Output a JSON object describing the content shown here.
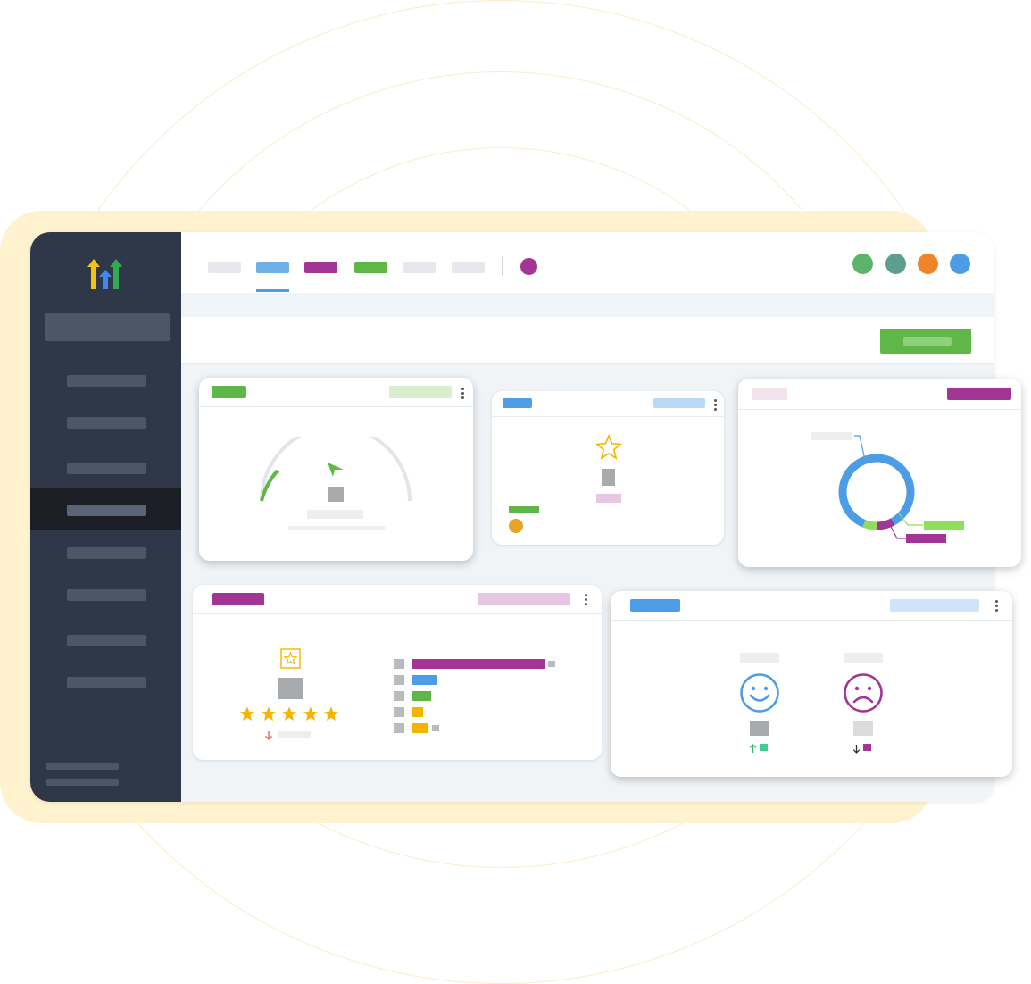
{
  "colors": {
    "sidebar": "#2e3848",
    "sidebar_active": "#1b1e25",
    "purple": "#a23596",
    "green": "#5fb748",
    "blue": "#4d9de6",
    "light_green": "#d9edcf",
    "light_blue": "#b8d8f6",
    "light_purple": "#e6c6e2",
    "orange": "#f18429",
    "teal": "#5e9e8c",
    "gold": "#f4b400",
    "backdrop": "#fff2cf"
  },
  "header": {
    "tabs": [
      {
        "name": "tab-1",
        "color": "#e6e8eb",
        "active": false
      },
      {
        "name": "tab-2",
        "color": "#6fb0e6",
        "active": true
      },
      {
        "name": "tab-3",
        "color": "#a23596",
        "active": false
      },
      {
        "name": "tab-4",
        "color": "#5fb748",
        "active": false
      },
      {
        "name": "tab-5",
        "color": "#e6e8eb",
        "active": false
      },
      {
        "name": "tab-6",
        "color": "#e6e8eb",
        "active": false
      }
    ],
    "status_dot_color": "#a23596",
    "avatars": [
      "#5ab46a",
      "#5e9e8c",
      "#f18429",
      "#4d9de6"
    ]
  },
  "icons": {
    "logo": "gohighlevel-arrows-icon",
    "gauge_pointer": "pointer-arrow-icon",
    "star_outline": "star-outline-icon",
    "star_box": "star-box-icon",
    "stars": "filled-star-icon",
    "trend_down": "arrow-down-icon",
    "trend_up": "arrow-up-icon",
    "happy": "smiley-face-icon",
    "sad": "sad-face-icon",
    "kebab": "more-vertical-icon"
  },
  "gauge": {
    "filled_fraction": 0.12
  },
  "donut": {
    "segments": [
      {
        "share": 0.86,
        "color": "#4d9de6"
      },
      {
        "share": 0.08,
        "color": "#a23596"
      },
      {
        "share": 0.06,
        "color": "#8ee05c"
      }
    ]
  },
  "rating": {
    "stars": 5
  },
  "bars": {
    "rows": [
      {
        "value": 1.0,
        "color": "#a23596"
      },
      {
        "value": 0.18,
        "color": "#4d9de6"
      },
      {
        "value": 0.14,
        "color": "#5fb748"
      },
      {
        "value": 0.08,
        "color": "#f4b400"
      },
      {
        "value": 0.12,
        "color": "#f4b400"
      }
    ]
  }
}
